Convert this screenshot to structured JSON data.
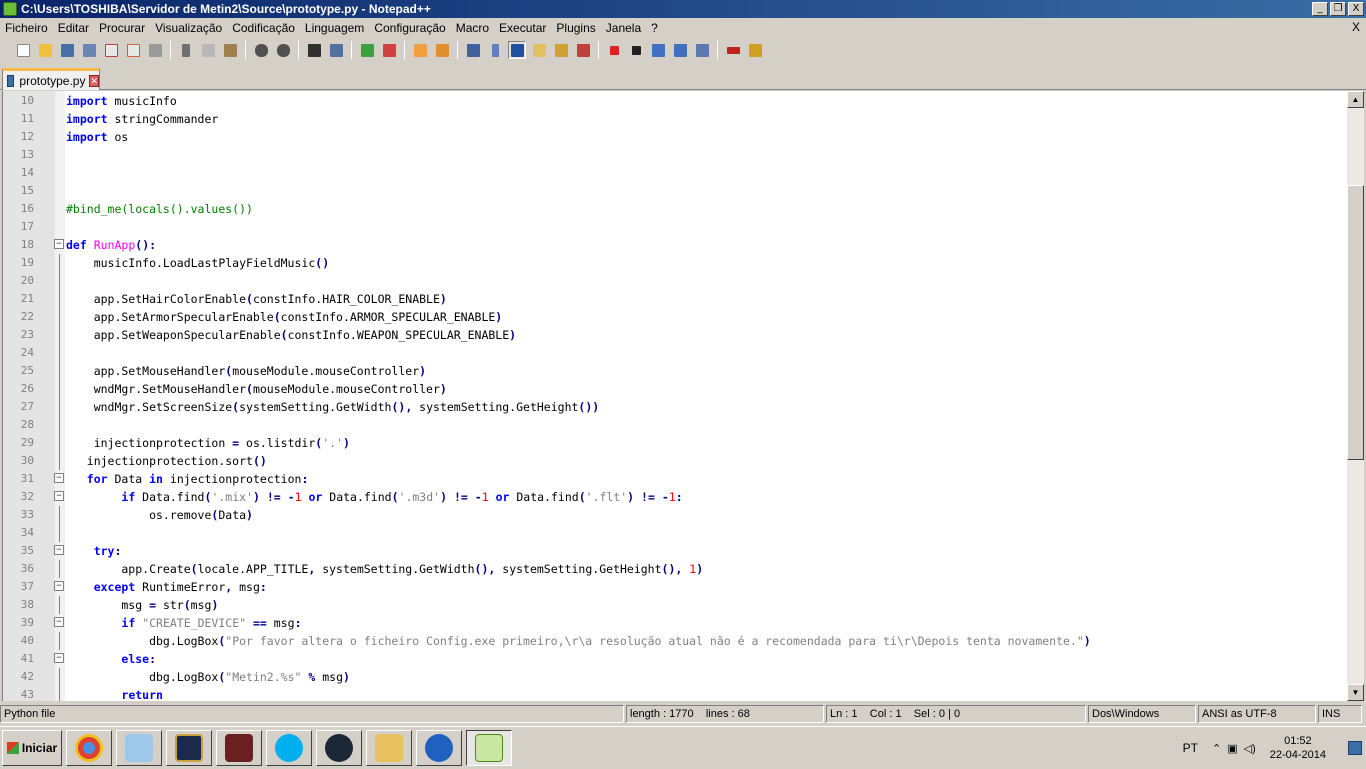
{
  "window": {
    "title": "C:\\Users\\TOSHIBA\\Servidor de Metin2\\Source\\prototype.py - Notepad++",
    "buttons": [
      "_",
      "❐",
      "X"
    ]
  },
  "menu": {
    "items": [
      "Ficheiro",
      "Editar",
      "Procurar",
      "Visualização",
      "Codificação",
      "Linguagem",
      "Configuração",
      "Macro",
      "Executar",
      "Plugins",
      "Janela",
      "?"
    ],
    "close_doc": "X"
  },
  "toolbar": {
    "icons": [
      "new-file-icon",
      "open-file-icon",
      "save-icon",
      "save-all-icon",
      "close-icon",
      "close-all-icon",
      "print-icon",
      "cut-icon",
      "copy-icon",
      "paste-icon",
      "undo-icon",
      "redo-icon",
      "find-icon",
      "replace-icon",
      "zoom-in-icon",
      "zoom-out-icon",
      "sync-vertical-icon",
      "sync-horizontal-icon",
      "word-wrap-icon",
      "show-all-chars-icon",
      "indent-guide-icon",
      "user-language-icon",
      "doc-map-icon",
      "function-list-icon",
      "record-macro-icon",
      "stop-macro-icon",
      "play-macro-icon",
      "run-macro-multiple-icon",
      "save-macro-icon",
      "spellcheck-icon",
      "plugin-icon"
    ],
    "active_icon": "indent-guide-icon"
  },
  "tabs": [
    {
      "label": "prototype.py",
      "close": "✕"
    }
  ],
  "editor": {
    "lines": [
      {
        "n": "10",
        "text": "import musicInfo",
        "fold": ""
      },
      {
        "n": "11",
        "text": "import stringCommander",
        "fold": ""
      },
      {
        "n": "12",
        "text": "import os",
        "fold": ""
      },
      {
        "n": "13",
        "text": "",
        "fold": ""
      },
      {
        "n": "14",
        "text": "",
        "fold": ""
      },
      {
        "n": "15",
        "text": "",
        "fold": ""
      },
      {
        "n": "16",
        "text": "#bind_me(locals().values())",
        "fold": ""
      },
      {
        "n": "17",
        "text": "",
        "fold": ""
      },
      {
        "n": "18",
        "text": "def RunApp():",
        "fold": "box"
      },
      {
        "n": "19",
        "text": "    musicInfo.LoadLastPlayFieldMusic()",
        "fold": "line"
      },
      {
        "n": "20",
        "text": "",
        "fold": "line"
      },
      {
        "n": "21",
        "text": "    app.SetHairColorEnable(constInfo.HAIR_COLOR_ENABLE)",
        "fold": "line"
      },
      {
        "n": "22",
        "text": "    app.SetArmorSpecularEnable(constInfo.ARMOR_SPECULAR_ENABLE)",
        "fold": "line"
      },
      {
        "n": "23",
        "text": "    app.SetWeaponSpecularEnable(constInfo.WEAPON_SPECULAR_ENABLE)",
        "fold": "line"
      },
      {
        "n": "24",
        "text": "",
        "fold": "line"
      },
      {
        "n": "25",
        "text": "    app.SetMouseHandler(mouseModule.mouseController)",
        "fold": "line"
      },
      {
        "n": "26",
        "text": "    wndMgr.SetMouseHandler(mouseModule.mouseController)",
        "fold": "line"
      },
      {
        "n": "27",
        "text": "    wndMgr.SetScreenSize(systemSetting.GetWidth(), systemSetting.GetHeight())",
        "fold": "line"
      },
      {
        "n": "28",
        "text": "",
        "fold": "line"
      },
      {
        "n": "29",
        "text": "    injectionprotection = os.listdir('.')",
        "fold": "line"
      },
      {
        "n": "30",
        "text": "   injectionprotection.sort()",
        "fold": "line"
      },
      {
        "n": "31",
        "text": "   for Data in injectionprotection:",
        "fold": "box"
      },
      {
        "n": "32",
        "text": "        if Data.find('.mix') != -1 or Data.find('.m3d') != -1 or Data.find('.flt') != -1:",
        "fold": "box"
      },
      {
        "n": "33",
        "text": "            os.remove(Data)",
        "fold": "line"
      },
      {
        "n": "34",
        "text": "",
        "fold": "line"
      },
      {
        "n": "35",
        "text": "    try:",
        "fold": "box"
      },
      {
        "n": "36",
        "text": "        app.Create(locale.APP_TITLE, systemSetting.GetWidth(), systemSetting.GetHeight(), 1)",
        "fold": "line"
      },
      {
        "n": "37",
        "text": "    except RuntimeError, msg:",
        "fold": "box"
      },
      {
        "n": "38",
        "text": "        msg = str(msg)",
        "fold": "line"
      },
      {
        "n": "39",
        "text": "        if \"CREATE_DEVICE\" == msg:",
        "fold": "box"
      },
      {
        "n": "40",
        "text": "            dbg.LogBox(\"Por favor altera o ficheiro Config.exe primeiro,\\r\\a resolução atual não é a recomendada para ti\\r\\Depois tenta novamente.\")",
        "fold": "line"
      },
      {
        "n": "41",
        "text": "        else:",
        "fold": "box"
      },
      {
        "n": "42",
        "text": "            dbg.LogBox(\"Metin2.%s\" % msg)",
        "fold": "line"
      },
      {
        "n": "43",
        "text": "        return",
        "fold": "line"
      }
    ]
  },
  "scrollbar": {
    "up": "▲",
    "down": "▼"
  },
  "statusbar": {
    "language": "Python file",
    "length": "length : 1770",
    "lines": "lines : 68",
    "ln": "Ln : 1",
    "col": "Col : 1",
    "sel": "Sel : 0 | 0",
    "eol": "Dos\\Windows",
    "encoding": "ANSI as UTF-8",
    "mode": "INS"
  },
  "taskbar": {
    "start": "Iniciar",
    "apps": [
      "chrome-icon",
      "notepad-icon",
      "league-of-legends-icon",
      "metin2-icon",
      "skype-icon",
      "steam-icon",
      "explorer-icon",
      "hotspot-shield-icon",
      "notepadpp-icon"
    ],
    "active_app": "notepadpp-icon",
    "lang": "PT",
    "time": "01:52",
    "date": "22-04-2014"
  },
  "colors": {
    "keyword": "#0000ff",
    "function": "#ff00ff",
    "comment": "#008000",
    "string": "#808080",
    "number": "#ff0000",
    "operator": "#000080",
    "tab_accent": "#fab848"
  }
}
